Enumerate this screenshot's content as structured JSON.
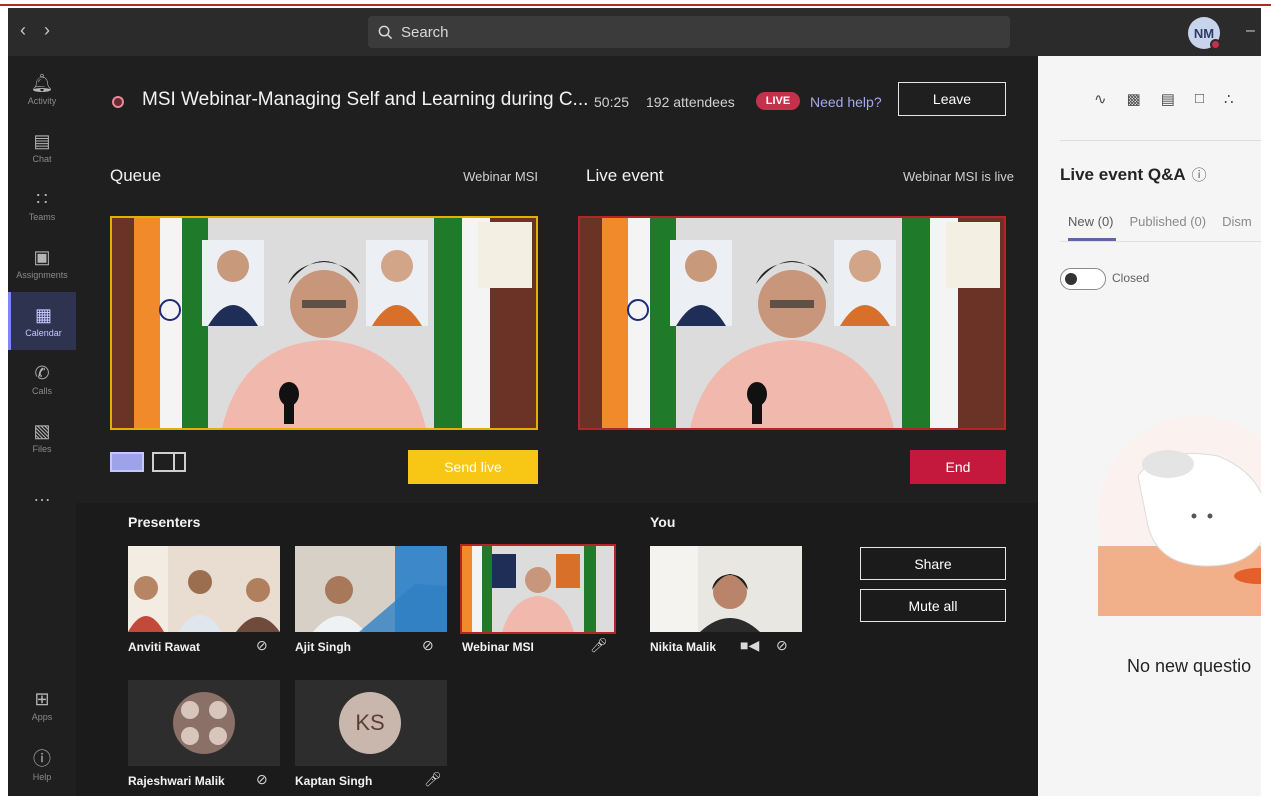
{
  "window": {
    "search_placeholder": "Search",
    "user_initials": "NM"
  },
  "rail": [
    {
      "label": "Activity",
      "icon": "bell-icon"
    },
    {
      "label": "Chat",
      "icon": "chat-icon"
    },
    {
      "label": "Teams",
      "icon": "teams-icon"
    },
    {
      "label": "Assignments",
      "icon": "assignments-icon"
    },
    {
      "label": "Calendar",
      "icon": "calendar-icon"
    },
    {
      "label": "Calls",
      "icon": "phone-icon"
    },
    {
      "label": "Files",
      "icon": "files-icon"
    },
    {
      "label": "Apps",
      "icon": "apps-icon"
    },
    {
      "label": "Help",
      "icon": "help-icon"
    }
  ],
  "event": {
    "title": "MSI Webinar-Managing Self and Learning during C...",
    "elapsed": "50:25",
    "attendees": "192 attendees",
    "live_badge": "LIVE",
    "help_link": "Need help?",
    "leave_label": "Leave"
  },
  "queue": {
    "title": "Queue",
    "subtitle": "Webinar MSI",
    "send_live_label": "Send live"
  },
  "live_event": {
    "title": "Live event",
    "subtitle": "Webinar MSI is live",
    "end_label": "End"
  },
  "presenters": {
    "heading": "Presenters",
    "tiles": [
      {
        "name": "Anviti Rawat",
        "status_icon": "mic-off-icon"
      },
      {
        "name": "Ajit Singh",
        "status_icon": "mic-off-icon"
      },
      {
        "name": "Webinar MSI",
        "status_icon": "mic-icon"
      },
      {
        "name": "Rajeshwari Malik",
        "status_icon": "mic-off-icon"
      },
      {
        "name": "Kaptan Singh",
        "status_icon": "mic-icon",
        "initials": "KS"
      }
    ]
  },
  "you": {
    "heading": "You",
    "name": "Nikita Malik",
    "share_label": "Share",
    "mute_all_label": "Mute all"
  },
  "qa": {
    "title": "Live event Q&A",
    "tabs": [
      "New (0)",
      "Published (0)",
      "Dism"
    ],
    "toggle_label": "Closed",
    "empty_text": "No new questio"
  },
  "colors": {
    "accent": "#6264a7",
    "live_red": "#c4314b",
    "queue_yellow": "#f8c614",
    "end_red": "#c4183c"
  }
}
